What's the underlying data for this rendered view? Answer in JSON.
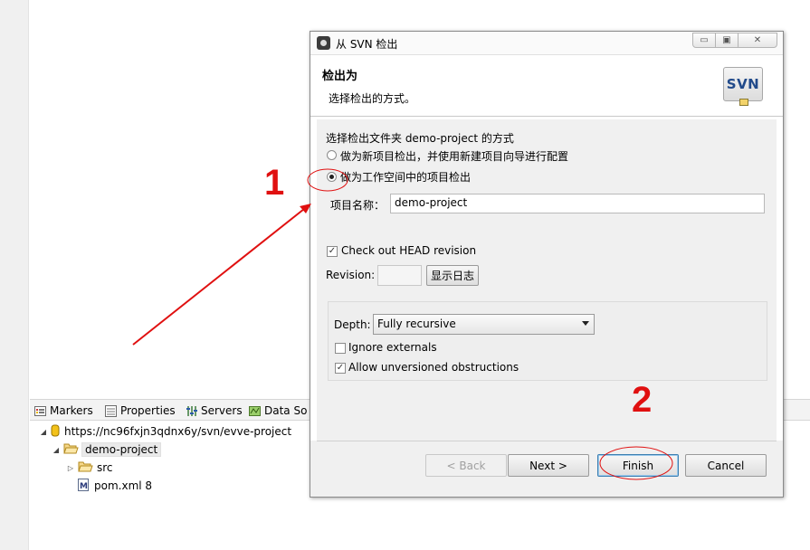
{
  "dialog": {
    "title": "从 SVN 检出",
    "window_buttons": {
      "min": "▭",
      "restore": "▣",
      "close": "✕"
    },
    "banner": {
      "title": "检出为",
      "description": "选择检出的方式。",
      "logo_text": "SVN"
    },
    "prompt": "选择检出文件夹 demo-project 的方式",
    "options": [
      {
        "label": "做为新项目检出，并使用新建项目向导进行配置",
        "selected": false
      },
      {
        "label": "做为工作空间中的项目检出",
        "selected": true
      }
    ],
    "project_name": {
      "label": "项目名称：",
      "value": "demo-project"
    },
    "checkout_head": {
      "label": "Check out HEAD revision",
      "checked": true
    },
    "revision": {
      "label": "Revision:",
      "value": "",
      "show_log_label": "显示日志"
    },
    "depth": {
      "label": "Depth:",
      "value": "Fully recursive"
    },
    "ignore_externals": {
      "label": "Ignore externals",
      "checked": false
    },
    "allow_unversioned": {
      "label": "Allow unversioned obstructions",
      "checked": true
    },
    "buttons": {
      "back": "< Back",
      "next": "Next >",
      "finish": "Finish",
      "cancel": "Cancel"
    }
  },
  "views": {
    "tabs": [
      {
        "label": "Markers",
        "icon": "markers-icon"
      },
      {
        "label": "Properties",
        "icon": "properties-icon"
      },
      {
        "label": "Servers",
        "icon": "servers-icon"
      },
      {
        "label": "Data So",
        "icon": "data-source-icon"
      }
    ],
    "tree": [
      {
        "label": "https://nc96fxjn3qdnx6y/svn/evve-project",
        "icon": "repository-icon",
        "expanded": true
      },
      {
        "label": "demo-project",
        "icon": "folder-open-icon",
        "expanded": true
      },
      {
        "label": "src",
        "icon": "folder-icon",
        "expanded": false
      },
      {
        "label": "pom.xml 8",
        "icon": "maven-file-icon"
      }
    ]
  },
  "annotations": {
    "step1": "1",
    "step2": "2",
    "color": "#e01010"
  }
}
